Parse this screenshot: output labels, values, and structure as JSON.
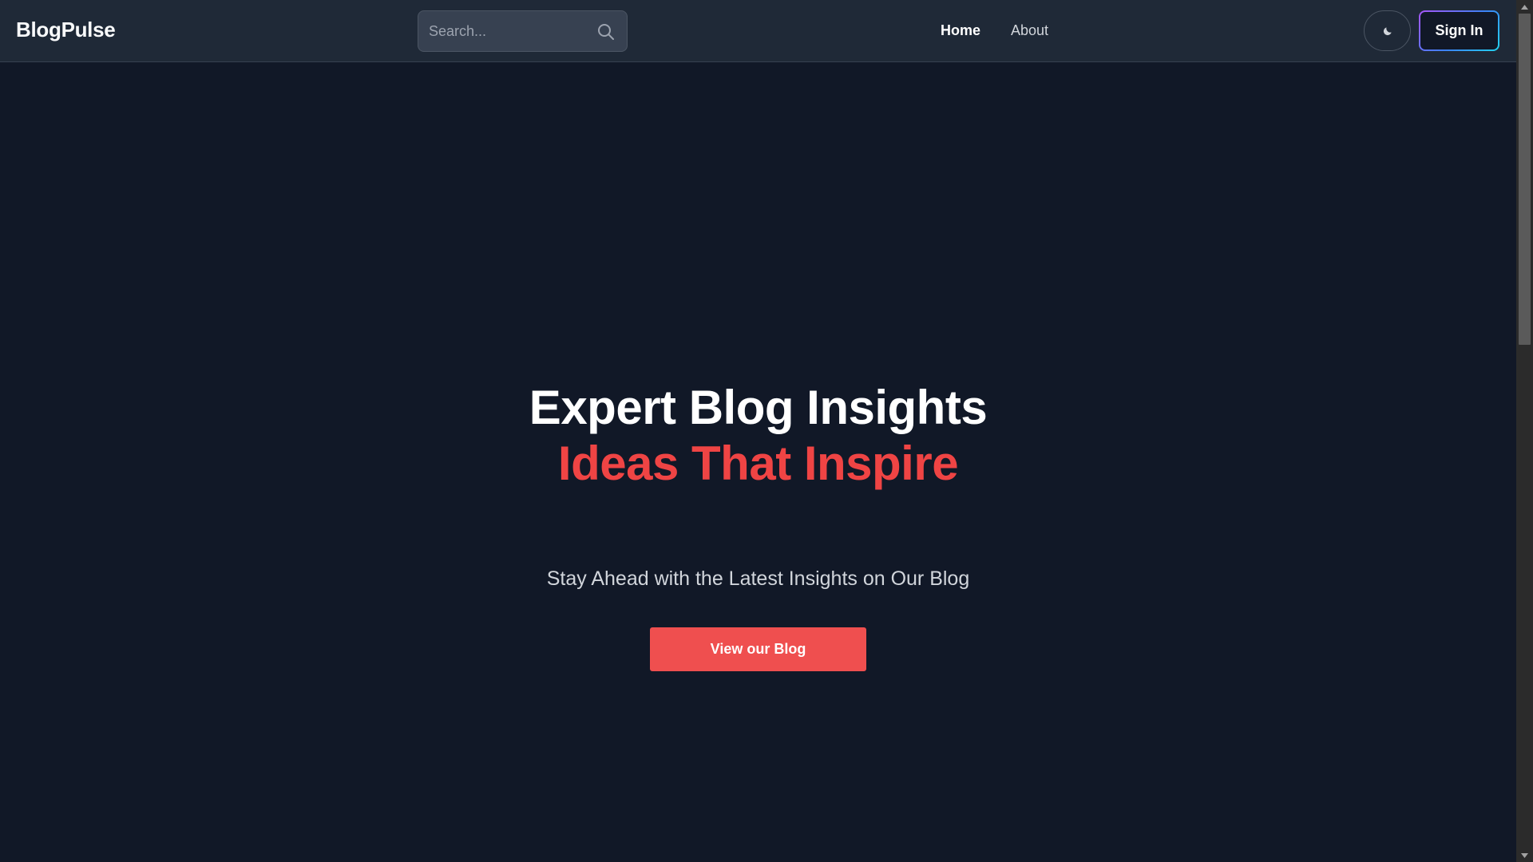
{
  "navbar": {
    "brand": "BlogPulse",
    "search": {
      "placeholder": "Search..."
    },
    "links": [
      {
        "label": "Home",
        "active": true
      },
      {
        "label": "About",
        "active": false
      }
    ],
    "theme_toggle_icon": "moon-icon",
    "signin_label": "Sign In"
  },
  "hero": {
    "title_line1": "Expert Blog Insights",
    "title_line2": "Ideas That Inspire",
    "subtitle": "Stay Ahead with the Latest Insights on Our Blog",
    "cta_label": "View our Blog"
  },
  "colors": {
    "background": "#111827",
    "navbar": "#1f2937",
    "accent": "#ef4444",
    "cta": "#ef4f4f"
  }
}
